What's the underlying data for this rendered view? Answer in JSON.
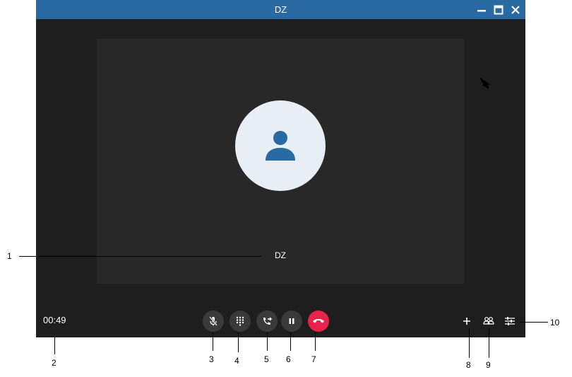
{
  "window": {
    "title": "DZ"
  },
  "call": {
    "participant_name": "DZ",
    "timer": "00:49"
  },
  "controls": [
    {
      "name": "mute",
      "icon": "microphone-off-icon"
    },
    {
      "name": "dialpad",
      "icon": "dialpad-icon"
    },
    {
      "name": "transfer",
      "icon": "call-transfer-icon"
    },
    {
      "name": "hold",
      "icon": "pause-icon"
    },
    {
      "name": "hangup",
      "icon": "hang-up-icon"
    }
  ],
  "tools": [
    {
      "name": "add",
      "icon": "plus-icon"
    },
    {
      "name": "participants",
      "icon": "people-icon"
    },
    {
      "name": "settings",
      "icon": "sliders-icon"
    }
  ],
  "callouts": [
    "1",
    "2",
    "3",
    "4",
    "5",
    "6",
    "7",
    "8",
    "9",
    "10"
  ],
  "colors": {
    "titlebar": "#2a6aa3",
    "background": "#1e1e1e",
    "video_area": "#282829",
    "avatar_bg": "#e7eef5",
    "avatar_icon": "#2a6aa3",
    "hangup": "#e8234a"
  }
}
